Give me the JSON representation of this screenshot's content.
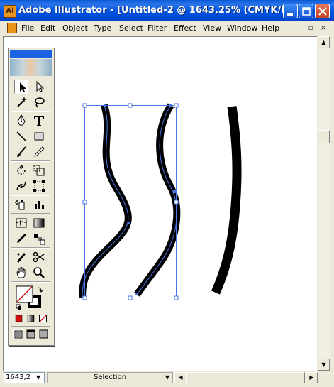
{
  "window": {
    "title": "Adobe Illustrator - [Untitled-2 @ 1643,25% (CMYK/Previe...",
    "app_icon": "illustrator-app-icon",
    "buttons": [
      "minimize-icon",
      "maximize-icon",
      "close-icon"
    ]
  },
  "menu": {
    "items": [
      "File",
      "Edit",
      "Object",
      "Type",
      "Select",
      "Filter",
      "Effect",
      "View",
      "Window",
      "Help"
    ],
    "doc_controls": [
      "–",
      "▫",
      "×"
    ]
  },
  "toolbox": {
    "tools": [
      "selection-tool-icon",
      "direct-selection-tool-icon",
      "magic-wand-tool-icon",
      "lasso-tool-icon",
      "pen-tool-icon",
      "type-tool-icon",
      "line-segment-tool-icon",
      "rectangle-tool-icon",
      "paintbrush-tool-icon",
      "pencil-tool-icon",
      "rotate-tool-icon",
      "scale-tool-icon",
      "warp-tool-icon",
      "free-transform-tool-icon",
      "symbol-sprayer-tool-icon",
      "graph-tool-icon",
      "mesh-tool-icon",
      "gradient-tool-icon",
      "eyedropper-tool-icon",
      "blend-tool-icon",
      "slice-tool-icon",
      "scissors-tool-icon",
      "hand-tool-icon",
      "zoom-tool-icon"
    ],
    "active_tool": "selection-tool-icon",
    "fill_color": "#ffffff",
    "stroke_color": "#000000",
    "accent_color": "#1c62e5"
  },
  "status": {
    "zoom": "1643,2",
    "tool_display": "Selection"
  }
}
